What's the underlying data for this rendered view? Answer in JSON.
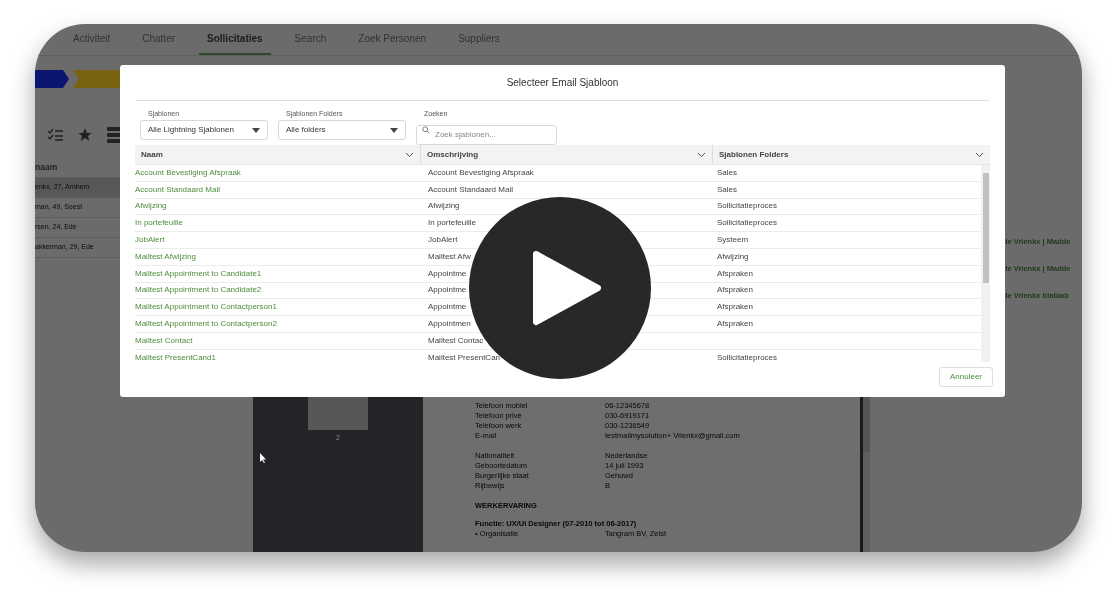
{
  "tabs": [
    {
      "label": "Activiteit",
      "selected": false
    },
    {
      "label": "Chatter",
      "selected": false
    },
    {
      "label": "Sollicitaties",
      "selected": true
    },
    {
      "label": "Search",
      "selected": false
    },
    {
      "label": "Zoek Personen",
      "selected": false
    },
    {
      "label": "Suppliers",
      "selected": false
    }
  ],
  "left_list": {
    "header": "naam",
    "rows": [
      {
        "text": "enkx, 27, Arnhem",
        "selected": true
      },
      {
        "text": "man, 49, Soest",
        "selected": false
      },
      {
        "text": "rsen, 24, Ede",
        "selected": false
      },
      {
        "text": "akkerman, 29, Ede",
        "selected": false
      }
    ]
  },
  "right_links": [
    "de Vrienkx | Madde",
    "de Vrienkx | Madde",
    "de Vrienkx blablab"
  ],
  "document": {
    "page_number": "2",
    "field_groups": [
      [
        {
          "label": "Telefoon mobiel",
          "value": "06-12345678"
        },
        {
          "label": "Telefoon privé",
          "value": "030-6919171"
        },
        {
          "label": "Telefoon werk",
          "value": "030-1236549"
        },
        {
          "label": "E-mail",
          "value": "testmailmysolution+ Vrienkx@gmail.com"
        }
      ],
      [
        {
          "label": "Nationaliteit",
          "value": "Nederlandse"
        },
        {
          "label": "Geboortedatum",
          "value": "14 juli 1993"
        },
        {
          "label": "Burgerlijke staat",
          "value": "Gehuwd"
        },
        {
          "label": "Rijbewijs",
          "value": "B"
        }
      ]
    ],
    "heading": "WERKERVARING",
    "job_title": "Functie: UX/UI Designer (07-2010 tot 06-2017)",
    "job_fields": [
      {
        "label": "• Organisatie",
        "value": "Tangram BV, Zeist"
      }
    ]
  },
  "dialog": {
    "title": "Selecteer Email Sjabloon",
    "filters": [
      {
        "kind": "select",
        "label": "Sjablonen",
        "value": "Alle Lightning Sjablonen"
      },
      {
        "kind": "select",
        "label": "Sjablonen Folders",
        "value": "Alle folders"
      },
      {
        "kind": "search",
        "label": "Zoeken",
        "placeholder": "Zoek sjablonen..."
      }
    ],
    "columns": [
      "Naam",
      "Omschrijving",
      "Sjablonen Folders"
    ],
    "rows": [
      {
        "name": "Account Bevestiging Afspraak",
        "description": "Account Bevestiging Afspraak",
        "folder": "Sales"
      },
      {
        "name": "Account Standaard Mail",
        "description": "Account Standaard Mail",
        "folder": "Sales"
      },
      {
        "name": "Afwijzing",
        "description": "Afwijzing",
        "folder": "Sollicitatieproces"
      },
      {
        "name": "In portefeuille",
        "description": "In portefeuille",
        "folder": "Sollicitatieproces"
      },
      {
        "name": "JobAlert",
        "description": "JobAlert",
        "folder": "Systeem"
      },
      {
        "name": "Mailtest Afwijzing",
        "description": "Mailtest Afw",
        "folder": "Afwijzing"
      },
      {
        "name": "Mailtest Appointment to Candidate1",
        "description": "Appointme",
        "folder": "Afspraken"
      },
      {
        "name": "Mailtest Appointment to Candidate2",
        "description": "Appointme",
        "folder": "Afspraken"
      },
      {
        "name": "Mailtest Appointment to Contactperson1",
        "description": "Appointme",
        "folder": "Afspraken"
      },
      {
        "name": "Mailtest Appointment to Contactperson2",
        "description": "Appointmen",
        "folder": "Afspraken"
      },
      {
        "name": "Mailtest Contact",
        "description": "Mailtest Contac"
      },
      {
        "name": "Mailtest PresentCand1",
        "description": "Mailtest PresentCan",
        "folder": "Sollicitatieproces"
      }
    ],
    "cancel_button": "Annuleer"
  }
}
